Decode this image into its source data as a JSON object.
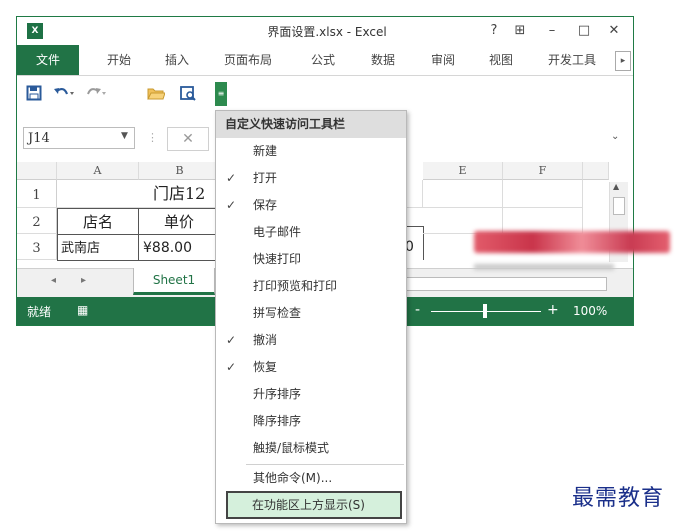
{
  "window": {
    "title": "界面设置.xlsx - Excel",
    "logo": "X",
    "help_btn": "?",
    "restore_ribbon_btn": "⊞",
    "minimize_btn": "–",
    "maximize_btn": "□",
    "close_btn": "✕"
  },
  "ribbon": {
    "tabs": [
      "文件",
      "开始",
      "插入",
      "页面布局",
      "公式",
      "数据",
      "审阅",
      "视图",
      "开发工具"
    ],
    "scroll_arrow": "▸"
  },
  "qat": {
    "save_icon": "floppy-icon",
    "undo_icon": "undo-icon",
    "redo_icon": "redo-icon",
    "open_icon": "folder-icon",
    "print_icon": "print-preview-icon",
    "customize_icon": "customize-dropdown-icon"
  },
  "formula_bar": {
    "name_box": "J14",
    "fx_separator": "⋮",
    "cancel_symbol": "✕"
  },
  "sheet": {
    "columns": [
      "A",
      "B",
      "E",
      "F"
    ],
    "rows": [
      "1",
      "2",
      "3"
    ],
    "cells": {
      "b1": "门店12",
      "a2": "店名",
      "b2": "单价",
      "a3": "武南店",
      "b3": "¥88.00",
      "d3": "0"
    }
  },
  "sheet_tabs": {
    "prev": "◂",
    "next": "▸",
    "active": "Sheet1"
  },
  "status_bar": {
    "ready": "就绪",
    "zoom_minus": "-",
    "zoom_plus": "+",
    "zoom_level": "100%",
    "zoom_fraction": 0.47
  },
  "menu": {
    "header": "自定义快速访问工具栏",
    "items": [
      {
        "label": "新建",
        "check": ""
      },
      {
        "label": "打开",
        "check": "✓"
      },
      {
        "label": "保存",
        "check": "✓"
      },
      {
        "label": "电子邮件",
        "check": ""
      },
      {
        "label": "快速打印",
        "check": ""
      },
      {
        "label": "打印预览和打印",
        "check": ""
      },
      {
        "label": "拼写检查",
        "check": ""
      },
      {
        "label": "撤消",
        "check": "✓"
      },
      {
        "label": "恢复",
        "check": "✓"
      },
      {
        "label": "升序排序",
        "check": ""
      },
      {
        "label": "降序排序",
        "check": ""
      },
      {
        "label": "触摸/鼠标模式",
        "check": ""
      },
      {
        "label": "其他命令(M)...",
        "check": ""
      }
    ],
    "show_below": "在功能区上方显示(S)"
  },
  "brand": "最需教育",
  "colors": {
    "excel_green": "#217346",
    "accent_highlight": "#d5f0dc"
  }
}
